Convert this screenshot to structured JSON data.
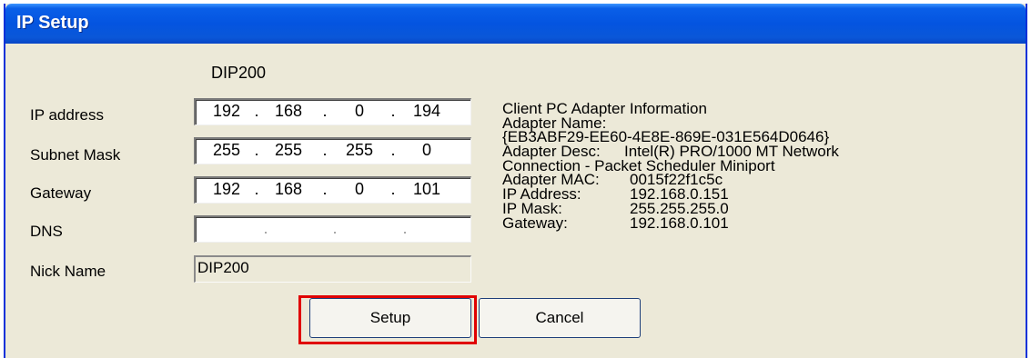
{
  "window": {
    "title": "IP Setup"
  },
  "device_name": "DIP200",
  "fields": {
    "ip_address": {
      "label": "IP address",
      "octets": [
        "192",
        "168",
        "0",
        "194"
      ]
    },
    "subnet_mask": {
      "label": "Subnet Mask",
      "octets": [
        "255",
        "255",
        "255",
        "0"
      ]
    },
    "gateway": {
      "label": "Gateway",
      "octets": [
        "192",
        "168",
        "0",
        "101"
      ]
    },
    "dns": {
      "label": "DNS",
      "octets": [
        "",
        "",
        "",
        ""
      ]
    },
    "nick_name": {
      "label": "Nick Name",
      "value": "DIP200"
    }
  },
  "adapter_info": {
    "heading": "Client PC Adapter Information",
    "name_label": "Adapter Name:",
    "name_value": "{EB3ABF29-EE60-4E8E-869E-031E564D0646}",
    "desc_label": "Adapter Desc:",
    "desc_value": "Intel(R) PRO/1000 MT Network",
    "desc_value_cont": "Connection - Packet Scheduler Miniport",
    "mac_label": "Adapter MAC:",
    "mac_value": "0015f22f1c5c",
    "ip_label": "IP Address:",
    "ip_value": "192.168.0.151",
    "mask_label": "IP Mask:",
    "mask_value": "255.255.255.0",
    "gateway_label": "Gateway:",
    "gateway_value": "192.168.0.101"
  },
  "buttons": {
    "setup": "Setup",
    "cancel": "Cancel"
  },
  "colors": {
    "highlight": "#e00000",
    "titlebar": "#0454e0",
    "dialog_bg": "#ece9d8"
  }
}
